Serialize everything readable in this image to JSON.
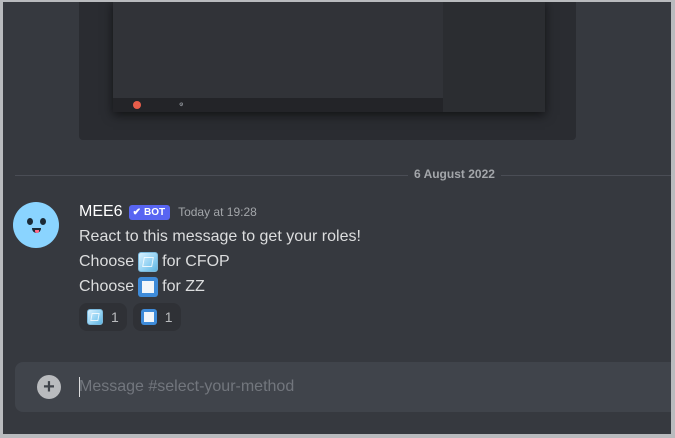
{
  "divider": {
    "date": "6 August 2022"
  },
  "message": {
    "author": "MEE6",
    "badge": "BOT",
    "badge_icon": "checkmark-icon",
    "timestamp": "Today at 19:28",
    "lines": [
      {
        "text": "React to this message to get your roles!"
      },
      {
        "prefix": "Choose",
        "emoji": "ice-cube-emoji",
        "suffix": "for CFOP"
      },
      {
        "prefix": "Choose",
        "emoji": "white-square-button-emoji",
        "suffix": "for ZZ"
      }
    ],
    "reactions": [
      {
        "emoji": "ice-cube-emoji",
        "count": "1"
      },
      {
        "emoji": "white-square-button-emoji",
        "count": "1"
      }
    ]
  },
  "composer": {
    "add_icon": "plus-circle-icon",
    "placeholder": "Message #select-your-method"
  },
  "colors": {
    "background": "#36393f",
    "accent": "#5865f2",
    "composer": "#40444b"
  }
}
